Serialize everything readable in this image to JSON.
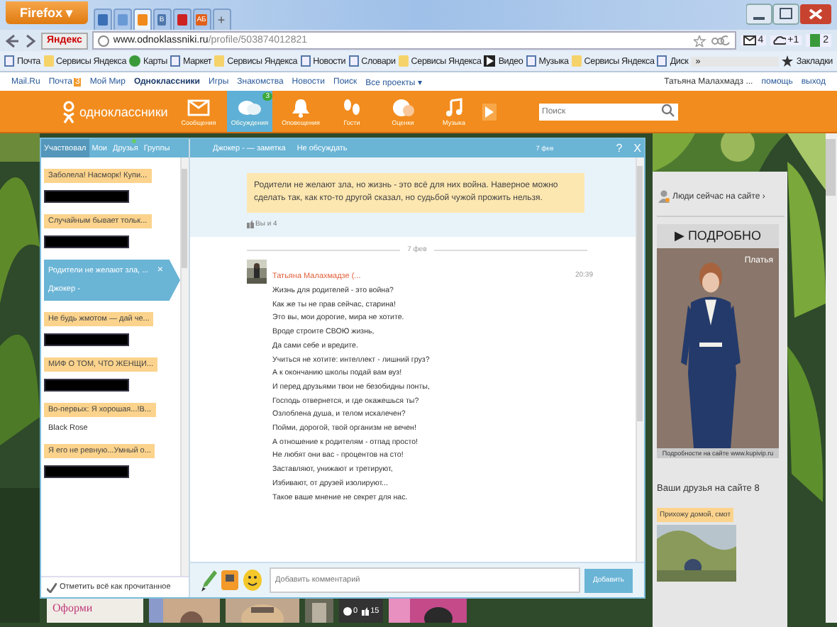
{
  "browser": {
    "menu_button": "Firefox ▾",
    "new_tab": "+",
    "tabs": [
      {
        "color": "#3b6fb6",
        "selected": false
      },
      {
        "color": "#6a9ad6",
        "selected": false
      },
      {
        "color": "#f08a1c",
        "selected": true
      },
      {
        "color": "#4f77ad",
        "label": "B",
        "selected": false
      },
      {
        "color": "#cc2222",
        "selected": false
      },
      {
        "color": "#e0601a",
        "label": "АБ",
        "selected": false
      }
    ],
    "engine": "Яндекс",
    "url_host": "www.odnoklassniki.ru",
    "url_path": "/profile/503874012821",
    "indicators": [
      {
        "kind": "mail",
        "label": "4"
      },
      {
        "kind": "weather",
        "label": "+1"
      },
      {
        "kind": "login",
        "label": "2"
      }
    ],
    "bookmarks": [
      {
        "kind": "page",
        "label": "Почта"
      },
      {
        "kind": "folder",
        "label": "Сервисы Яндекса"
      },
      {
        "kind": "map",
        "label": "Карты"
      },
      {
        "kind": "page",
        "label": "Маркет"
      },
      {
        "kind": "folder",
        "label": "Сервисы Яндекса"
      },
      {
        "kind": "page",
        "label": "Новости"
      },
      {
        "kind": "page",
        "label": "Словари"
      },
      {
        "kind": "folder",
        "label": "Сервисы Яндекса"
      },
      {
        "kind": "video",
        "label": "Видео"
      },
      {
        "kind": "page",
        "label": "Музыка"
      },
      {
        "kind": "folder",
        "label": "Сервисы Яндекса"
      },
      {
        "kind": "page",
        "label": "Диск"
      }
    ],
    "bookmarks_overflow": "»",
    "bookmarks_menu": "Закладки"
  },
  "portal_bar": {
    "links": [
      {
        "label": "Mail.Ru",
        "bold": false
      },
      {
        "label": "Почта",
        "bold": false,
        "badge": "3"
      },
      {
        "label": "Мой Мир",
        "bold": false
      },
      {
        "label": "Одноклассники",
        "bold": true
      },
      {
        "label": "Игры",
        "bold": false
      },
      {
        "label": "Знакомства",
        "bold": false
      },
      {
        "label": "Новости",
        "bold": false
      },
      {
        "label": "Поиск",
        "bold": false
      },
      {
        "label": "Все проекты ▾",
        "bold": false
      }
    ],
    "user": "Татьяна Малахмадз ...",
    "help": "помощь",
    "logout": "выход"
  },
  "site_nav": {
    "logo": "одноклассники",
    "items": [
      {
        "kind": "messages",
        "label": "Сообщения",
        "selected": false
      },
      {
        "kind": "discussions",
        "label": "Обсуждения",
        "selected": true,
        "badge": "3"
      },
      {
        "kind": "alerts",
        "label": "Оповещения",
        "selected": false
      },
      {
        "kind": "guests",
        "label": "Гости",
        "selected": false
      },
      {
        "kind": "ratings",
        "label": "Оценки",
        "selected": false
      },
      {
        "kind": "music",
        "label": "Музыка",
        "selected": false
      }
    ],
    "search_placeholder": "Поиск"
  },
  "discussions": {
    "tabs": [
      {
        "label": "Участвовал",
        "selected": true
      },
      {
        "label": "Мои",
        "selected": false
      },
      {
        "label": "Друзья",
        "selected": false,
        "new": true
      },
      {
        "label": "Группы",
        "selected": false
      }
    ],
    "items": [
      {
        "title": "Заболела! Насморк! Купи...",
        "redacted": true,
        "selected": false
      },
      {
        "title": "Случайным бывает тольк...",
        "redacted": true,
        "selected": false
      },
      {
        "title": "Родители не желают зла, ...",
        "author": "Джокер -",
        "close": "×",
        "selected": true
      },
      {
        "title": "Не будь жмотом — дай че...",
        "redacted": true,
        "selected": false
      },
      {
        "title": "МИФ О ТОМ, ЧТО ЖЕНЩИ...",
        "redacted": true,
        "selected": false
      },
      {
        "title": "Во-первых: Я хорошая...!В...",
        "author": "Black Rose",
        "selected": false
      },
      {
        "title": "Я его не ревную...Умный о...",
        "redacted": true,
        "selected": false
      }
    ],
    "mark_all": "Отметить всё как прочитанное"
  },
  "thread": {
    "header": "Джокер - — заметка",
    "mute": "Не обсуждать",
    "date": "7 фев",
    "help": "?",
    "close": "X",
    "note": "Родители не желают зла, но жизнь - это всё для них война. Наверное можно сделать так, как кто-то другой сказал, но судьбой чужой прожить нельзя.",
    "likes": "Вы и 4",
    "divider_date": "7 фев",
    "comment": {
      "author": "Татьяна Малахмадзе (...",
      "time": "20:39",
      "lines": [
        "Жизнь для родителей - это война?",
        "Как же ты не прав сейчас, старина!",
        "Это вы, мои дорогие, мира не хотите.",
        "Вроде строите СВОЮ жизнь,",
        "Да сами себе и вредите.",
        "Учиться не хотите: интеллект - лишний груз?",
        "А к окончанию школы подай вам вуз!",
        "И перед друзьями твои не безобидны понты,",
        "Господь отвернется, и где окажешься ты?",
        "Озлоблена душа, и телом искалечен?",
        "Пойми, дорогой, твой организм не вечен!",
        "А отношение к родителям - отпад просто!",
        "Не любят они вас - процентов на сто!",
        "Заставляют, унижают и третируют,",
        "Избивают, от друзей изолируют...",
        "Такое ваше мнение не секрет для нас."
      ]
    },
    "composer_placeholder": "Добавить комментарий",
    "send": "Добавить"
  },
  "feed": {
    "promo": "Оформи",
    "comments_count": "0",
    "likes_count": "15"
  },
  "sidebar": {
    "people_online": "Люди сейчас на сайте ›",
    "ad": {
      "button": "▶ ПОДРОБНО",
      "caption": "Платья",
      "fine_print": "Подробности на сайте www.kupivip.ru"
    },
    "friends_title": "Ваши друзья на сайте 8",
    "friend_status": "Прихожу домой, смот"
  }
}
